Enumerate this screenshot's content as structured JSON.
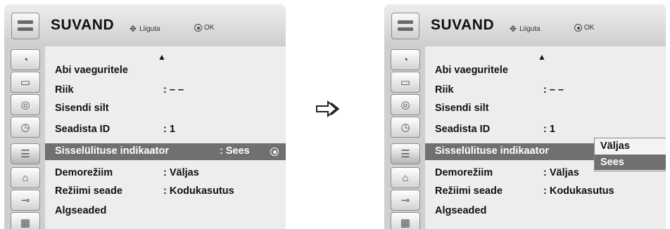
{
  "left": {
    "header": {
      "title": "SUVAND",
      "move_label": "Liiguta",
      "ok_label": "OK"
    },
    "scroll_up": "▲",
    "rows": [
      {
        "label": "Abi vaeguritele",
        "value": ""
      },
      {
        "label": "Riik",
        "value": ": – –"
      },
      {
        "label": "Sisendi silt",
        "value": ""
      },
      {
        "label": "Seadista ID",
        "value": ": 1"
      },
      {
        "label": "Sisselülituse indikaator",
        "value": ": Sees"
      },
      {
        "label": "Demorežiim",
        "value": ": Väljas"
      },
      {
        "label": "Režiimi seade",
        "value": ": Kodukasutus"
      },
      {
        "label": "Algseaded",
        "value": ""
      }
    ]
  },
  "right": {
    "header": {
      "title": "SUVAND",
      "move_label": "Liiguta",
      "ok_label": "OK"
    },
    "scroll_up": "▲",
    "rows": [
      {
        "label": "Abi vaeguritele",
        "value": ""
      },
      {
        "label": "Riik",
        "value": ": – –"
      },
      {
        "label": "Sisendi silt",
        "value": ""
      },
      {
        "label": "Seadista ID",
        "value": ": 1"
      },
      {
        "label": "Sisselülituse indikaator",
        "value": ""
      },
      {
        "label": "Demorežiim",
        "value": ": Väljas"
      },
      {
        "label": "Režiimi seade",
        "value": ": Kodukasutus"
      },
      {
        "label": "Algseaded",
        "value": ""
      }
    ],
    "popup": {
      "options": [
        "Väljas",
        "Sees"
      ],
      "selected": "Sees"
    }
  },
  "icons": [
    "satellite-dish-icon",
    "monitor-icon",
    "speaker-icon",
    "clock-icon",
    "option-toolbox-icon",
    "lock-icon",
    "input-plug-icon",
    "usb-clapper-icon"
  ],
  "transition_arrow": "⇨"
}
